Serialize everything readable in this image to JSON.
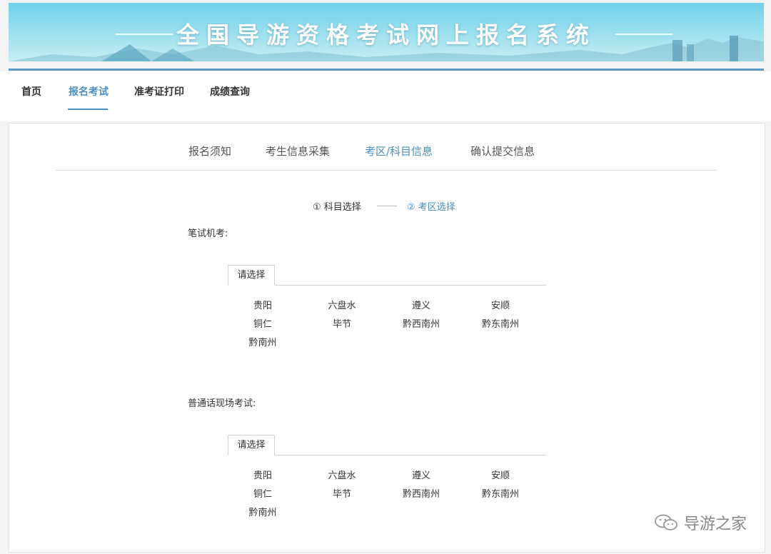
{
  "banner": {
    "title": "全国导游资格考试网上报名系统"
  },
  "nav": {
    "items": [
      "首页",
      "报名考试",
      "准考证打印",
      "成绩查询"
    ],
    "active_index": 1
  },
  "steps": [
    "报名须知",
    "考生信息采集",
    "考区/科目信息",
    "确认提交信息"
  ],
  "substeps": {
    "first": "① 科目选择",
    "second": "② 考区选择"
  },
  "sections": [
    {
      "label": "笔试机考:",
      "tab": "请选择",
      "cities": [
        "贵阳",
        "六盘水",
        "遵义",
        "安顺",
        "铜仁",
        "毕节",
        "黔西南州",
        "黔东南州",
        "黔南州"
      ]
    },
    {
      "label": "普通话现场考试:",
      "tab": "请选择",
      "cities": [
        "贵阳",
        "六盘水",
        "遵义",
        "安顺",
        "铜仁",
        "毕节",
        "黔西南州",
        "黔东南州",
        "黔南州"
      ]
    }
  ],
  "watermark": {
    "text": "导游之家"
  },
  "colors": {
    "accent": "#4a90c0",
    "banner": "#6fd1ea",
    "rule": "#5b9bc8"
  }
}
